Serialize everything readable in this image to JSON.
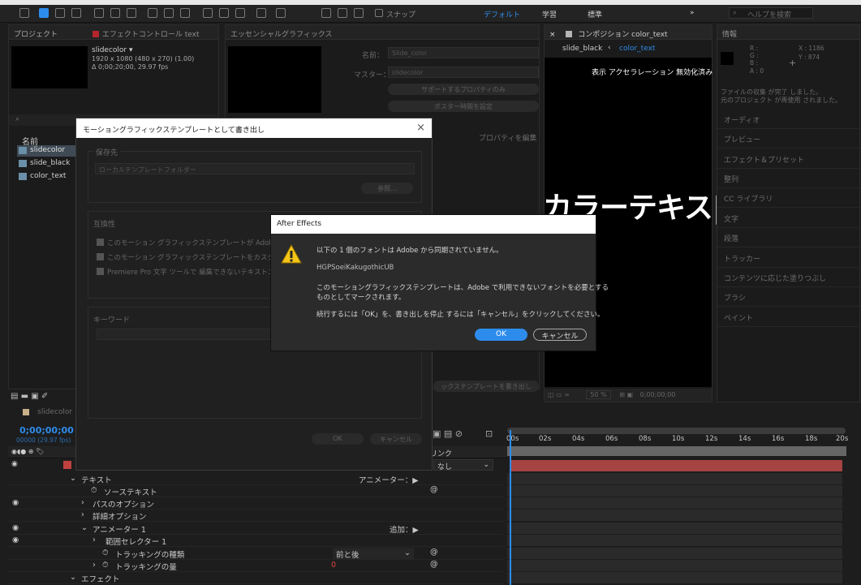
{
  "toolbar": {
    "snap": "スナップ",
    "workspaces": [
      "デフォルト",
      "学習",
      "標準"
    ],
    "search": "ヘルプを検索"
  },
  "project_panel": {
    "tab": "プロジェクト",
    "fx_tab": "エフェクトコントロール text",
    "comp_name": "slidecolor ▾",
    "comp_size": "1920 x 1080  (480 x 270) (1.00)",
    "comp_dur": "Δ 0;00;20;00, 29.97 fps",
    "col_name": "名前",
    "items": [
      "slidecolor",
      "slide_black",
      "color_text"
    ]
  },
  "eg_panel": {
    "tab": "エッセンシャルグラフィックス",
    "name_label": "名前：",
    "name_value": "Slide_color",
    "master_label": "マスター：",
    "master_value": "slidecolor",
    "btn_support": "サポートするプロパティのみ",
    "btn_poster": "ポスター時間を設定",
    "edit_props": "プロパティを編集",
    "export_btn": "ックステンプレートを書き出し"
  },
  "comp_panel": {
    "tab": "コンポジション color_text",
    "breadcrumb_left": "slide_black",
    "breadcrumb_right": "color_text",
    "notice": "表示 アクセラレーション 無効化済み",
    "big_text": "カラーテキス|",
    "zoom": "50 %",
    "time": "0;00;00;00"
  },
  "info_panel": {
    "tab": "情報",
    "r": "R :",
    "g": "G :",
    "b": "B :",
    "a": "A : 0",
    "x": "X : 1186",
    "y": "Y : 874",
    "msg1": "ファイルの収集 が完了 しました。",
    "msg2": "元のプロジェクト が再使用 されました。",
    "items": [
      "オーディオ",
      "プレビュー",
      "エフェクト＆プリセット",
      "整列",
      "CC ライブラリ",
      "文字",
      "段落",
      "トラッカー",
      "コンテンツに応じた塗りつぶし",
      "ブラシ",
      "ペイント"
    ]
  },
  "export_dialog": {
    "title": "モーショングラフィックステンプレートとして書き出し",
    "dest_label": "保存先",
    "dest_value": "ローカルテンプレートフォルダー",
    "browse": "参照...",
    "compat_label": "互換性",
    "opt1": "このモーション グラフィックステンプレートが Adobe Font",
    "opt2": "このモーション グラフィックステンプレートをカスタマイズ",
    "opt3": "Premiere Pro 文字 ツールで 編集できないテキストユ",
    "keyword_label": "キーワード",
    "ok": "OK",
    "cancel": "キャンセル"
  },
  "alert": {
    "title": "After Effects",
    "line1": "以下の 1 個のフォントは Adobe から同期されていません。",
    "font": "HGPSoeiKakugothicUB",
    "line2": "このモーショングラフィックステンプレートは、Adobe で利用できないフォントを必要とする",
    "line3": "ものとしてマークされます。",
    "line4": "続行するには「OK」を、書き出しを停止 するには「キャンセル」をクリックしてください。",
    "ok": "OK",
    "cancel": "キャンセル"
  },
  "timeline": {
    "tab": "slidecolor",
    "timecode": "0;00;00;00",
    "frames": "00000 (29.97 fps)",
    "parent_label": "リンク",
    "parent_value": "なし",
    "ticks": [
      "00s",
      "02s",
      "04s",
      "06s",
      "08s",
      "10s",
      "12s",
      "14s",
      "16s",
      "18s",
      "20s"
    ],
    "rows": [
      {
        "label": "テキスト",
        "right": "アニメーター：▶"
      },
      {
        "label": "ソーステキスト",
        "right": ""
      },
      {
        "label": "パスのオプション",
        "right": ""
      },
      {
        "label": "詳細オプション",
        "right": ""
      },
      {
        "label": "アニメーター 1",
        "right": "追加：▶"
      },
      {
        "label": "範囲セレクター 1",
        "right": ""
      },
      {
        "label": "トラッキングの種類",
        "right": "前と後"
      },
      {
        "label": "トラッキングの量",
        "right": "0"
      },
      {
        "label": "エフェクト",
        "right": ""
      }
    ]
  }
}
